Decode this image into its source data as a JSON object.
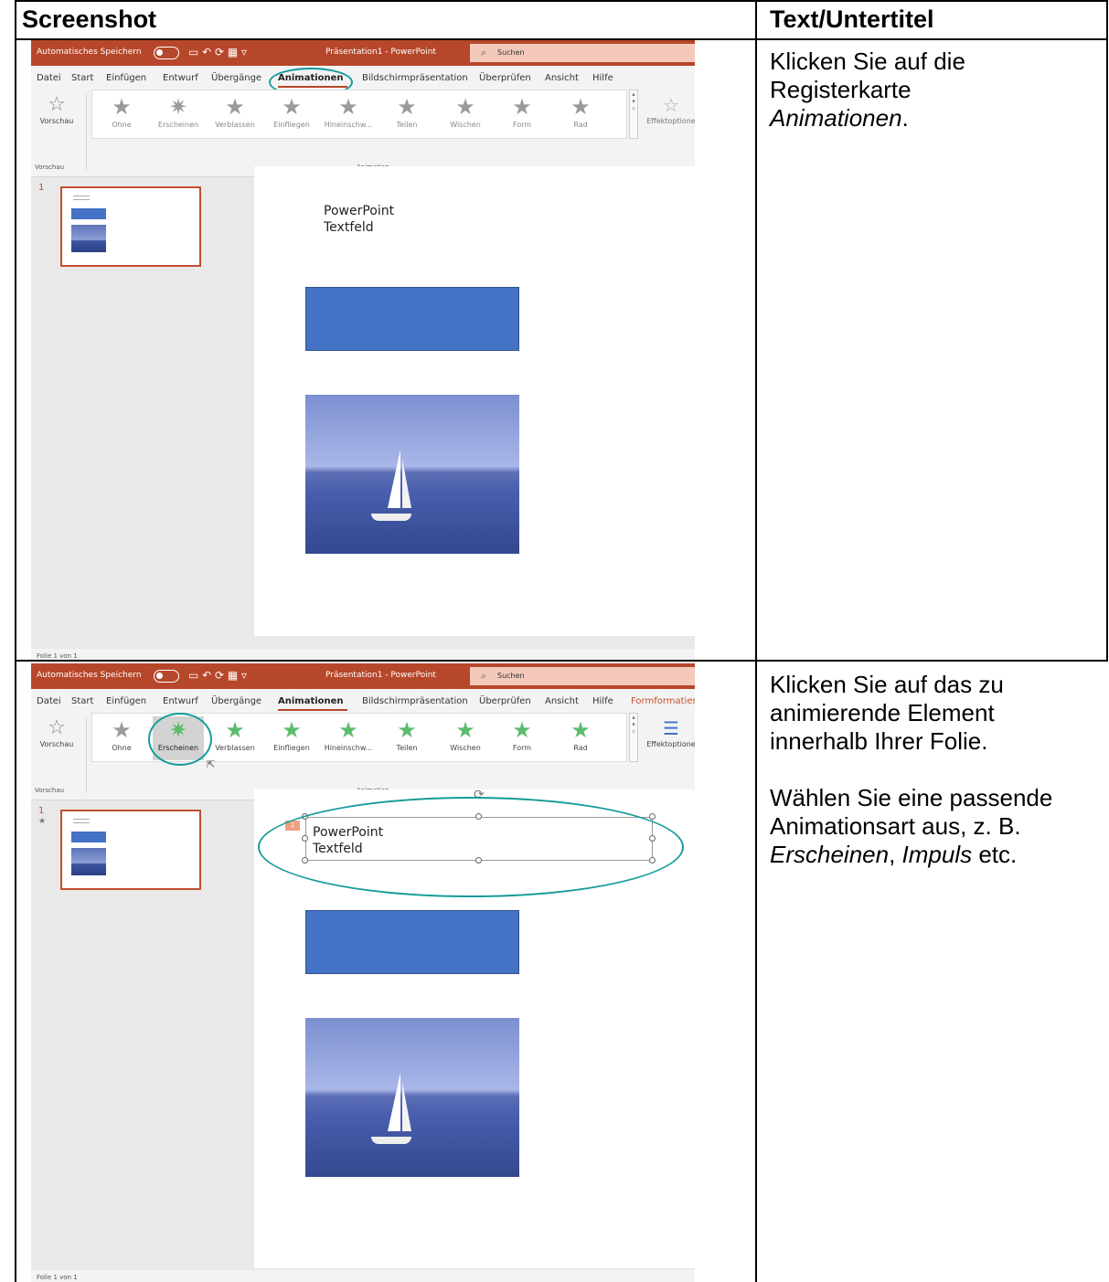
{
  "header": {
    "col1": "Screenshot",
    "col2": "Text/Untertitel"
  },
  "rows": [
    {
      "note_line1": "Klicken Sie auf die",
      "note_line2": "Registerkarte",
      "note_italic": "Animationen",
      "note_tail": "."
    },
    {
      "note_p1": "Klicken Sie auf das zu animierende Element innerhalb Ihrer Folie.",
      "note_p2_a": "Wählen Sie eine passende Animationsart aus, z. B. ",
      "note_p2_i1": "Erscheinen",
      "note_p2_b": ", ",
      "note_p2_i2": "Impuls",
      "note_p2_c": " etc."
    }
  ],
  "ppt": {
    "autosave": "Automatisches Speichern",
    "title": "Präsentation1  -  PowerPoint",
    "search": "Suchen",
    "menu": [
      "Datei",
      "Start",
      "Einfügen",
      "Entwurf",
      "Übergänge",
      "Animationen",
      "Bildschirmpräsentation",
      "Überprüfen",
      "Ansicht",
      "Hilfe"
    ],
    "menu_extra": "Formformatier",
    "preview": "Vorschau",
    "animations": [
      "Ohne",
      "Erscheinen",
      "Verblassen",
      "Einfliegen",
      "Hineinschw...",
      "Teilen",
      "Wischen",
      "Form",
      "Rad"
    ],
    "effect": "Effektoptione",
    "group_preview": "Vorschau",
    "group_animation": "Animation",
    "slide_num": "1",
    "textbox_l1": "PowerPoint",
    "textbox_l2": "Textfeld",
    "anim_tag": "1",
    "status": "Folie 1 von 1"
  },
  "colors": {
    "accent": "#b7472a",
    "highlight": "#169b9b",
    "shape": "#4472c4"
  }
}
